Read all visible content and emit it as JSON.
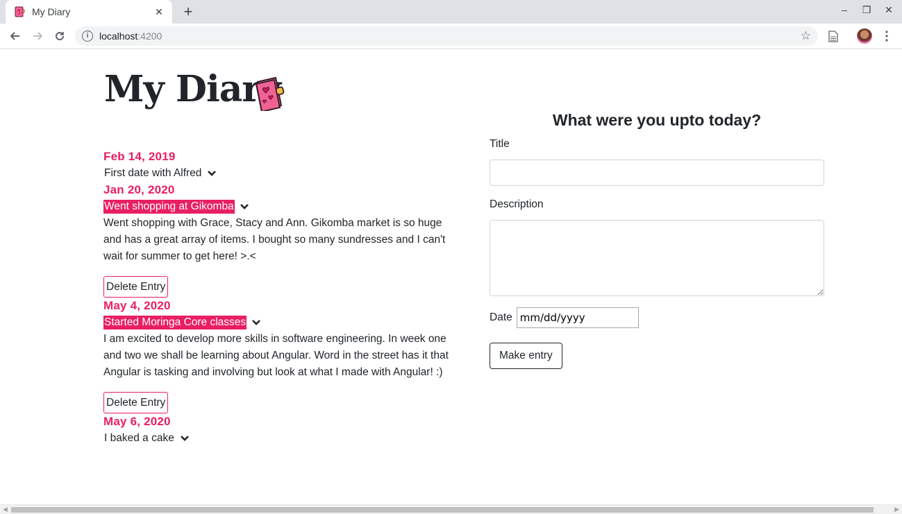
{
  "browser": {
    "tab_title": "My Diary",
    "tab_close": "✕",
    "new_tab": "+",
    "url_host": "localhost",
    "url_port": ":4200",
    "window_controls": {
      "minimize": "–",
      "maximize": "❐",
      "close": "✕"
    }
  },
  "app": {
    "title": "My Diary"
  },
  "entries": [
    {
      "date": "Feb 14, 2019",
      "title": "First date with Alfred",
      "expanded": false
    },
    {
      "date": "Jan 20, 2020",
      "title": "Went shopping at Gikomba",
      "expanded": true,
      "description": "Went shopping with Grace, Stacy and Ann. Gikomba market is so huge and has a great array of items. I bought so many sundresses and I can't wait for summer to get here! >.<",
      "delete_label": "Delete Entry"
    },
    {
      "date": "May 4, 2020",
      "title": "Started Moringa Core classes",
      "expanded": true,
      "description": "I am excited to develop more skills in software engineering. In week one and two we shall be learning about Angular. Word in the street has it that Angular is tasking and involving but look at what I made with Angular! :)",
      "delete_label": "Delete Entry"
    },
    {
      "date": "May 6, 2020",
      "title": "I baked a cake",
      "expanded": false
    }
  ],
  "form": {
    "heading": "What were you upto today?",
    "title_label": "Title",
    "title_value": "",
    "description_label": "Description",
    "description_value": "",
    "date_label": "Date",
    "date_placeholder": "mm/dd/yyyy",
    "submit_label": "Make entry"
  },
  "colors": {
    "accent": "#e91e63",
    "text": "#212529"
  },
  "icons": {
    "favicon": "diary-book-icon",
    "chevron": "chevron-down-icon"
  }
}
